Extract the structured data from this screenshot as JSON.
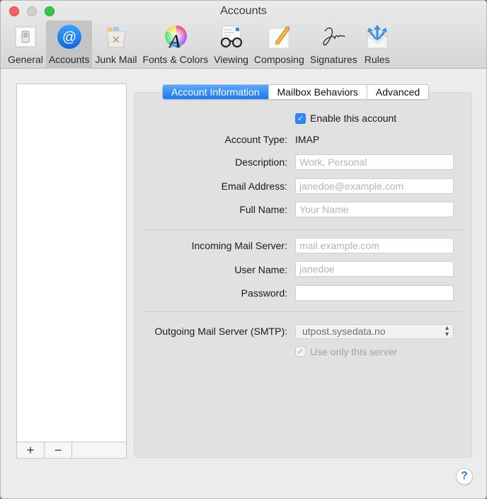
{
  "window": {
    "title": "Accounts"
  },
  "toolbar": {
    "items": [
      {
        "label": "General",
        "icon": "switch-icon",
        "selected": false
      },
      {
        "label": "Accounts",
        "icon": "at-sign-icon",
        "selected": true
      },
      {
        "label": "Junk Mail",
        "icon": "trash-bin-icon",
        "selected": false
      },
      {
        "label": "Fonts & Colors",
        "icon": "font-color-wheel-icon",
        "selected": false
      },
      {
        "label": "Viewing",
        "icon": "glasses-letter-icon",
        "selected": false
      },
      {
        "label": "Composing",
        "icon": "pencil-paper-icon",
        "selected": false
      },
      {
        "label": "Signatures",
        "icon": "signature-icon",
        "selected": false
      },
      {
        "label": "Rules",
        "icon": "envelope-arrows-icon",
        "selected": false
      }
    ]
  },
  "account_list": {
    "add_label": "+",
    "remove_label": "−"
  },
  "tabs": [
    {
      "label": "Account Information",
      "active": true
    },
    {
      "label": "Mailbox Behaviors",
      "active": false
    },
    {
      "label": "Advanced",
      "active": false
    }
  ],
  "form": {
    "enable_account": {
      "label": "Enable this account",
      "checked": true
    },
    "account_type": {
      "label": "Account Type:",
      "value": "IMAP"
    },
    "description": {
      "label": "Description:",
      "value": "",
      "placeholder": "Work, Personal"
    },
    "email": {
      "label": "Email Address:",
      "value": "",
      "placeholder": "janedoe@example.com"
    },
    "full_name": {
      "label": "Full Name:",
      "value": "",
      "placeholder": "Your Name"
    },
    "incoming_server": {
      "label": "Incoming Mail Server:",
      "value": "",
      "placeholder": "mail.example.com"
    },
    "user_name": {
      "label": "User Name:",
      "value": "",
      "placeholder": "janedoe"
    },
    "password": {
      "label": "Password:",
      "value": ""
    },
    "outgoing_server": {
      "label": "Outgoing Mail Server (SMTP):",
      "value": "utpost.sysedata.no"
    },
    "use_only_server": {
      "label": "Use only this server",
      "checked": true,
      "disabled": true
    }
  },
  "help": {
    "label": "?"
  },
  "colors": {
    "accent": "#1a78f2",
    "close": "#fc605c",
    "maximize": "#34c84a"
  }
}
